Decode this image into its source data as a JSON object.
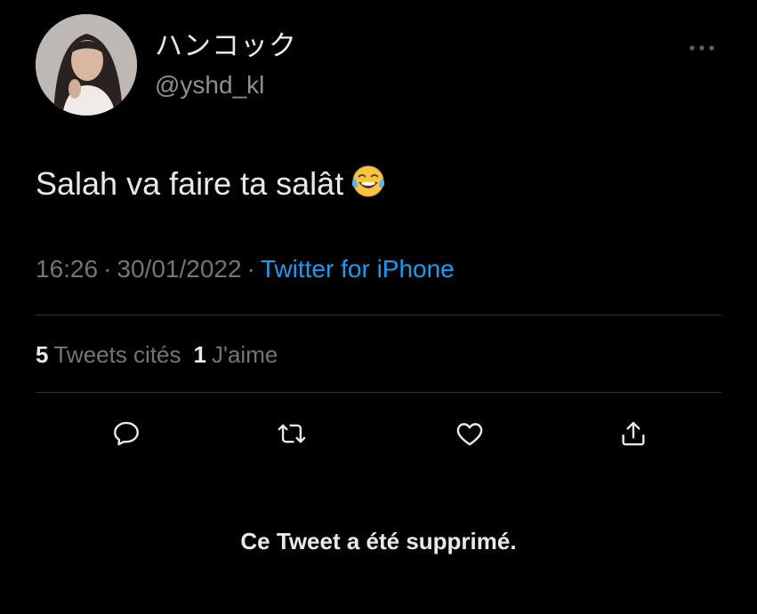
{
  "tweet": {
    "author": {
      "display_name": "ハンコック",
      "handle": "@yshd_kl",
      "avatar_icon": "profile-photo"
    },
    "text": "Salah va faire ta salât",
    "emoji_icon": "face-with-tears-of-joy-emoji",
    "time": "16:26",
    "date": "30/01/2022",
    "separator": "·",
    "source": "Twitter for iPhone",
    "stats": {
      "quotes_count": "5",
      "quotes_label": "Tweets cités",
      "likes_count": "1",
      "likes_label": "J'aime"
    },
    "actions": {
      "reply_icon": "reply-icon",
      "retweet_icon": "retweet-icon",
      "like_icon": "heart-icon",
      "share_icon": "share-icon"
    },
    "more_icon": "more-options-icon"
  },
  "notice": {
    "deleted_text": "Ce Tweet a été supprimé."
  },
  "colors": {
    "background": "#000000",
    "text_primary": "#e7e9ea",
    "text_secondary": "#71767b",
    "link": "#1d9bf0",
    "divider": "#2f3336"
  }
}
